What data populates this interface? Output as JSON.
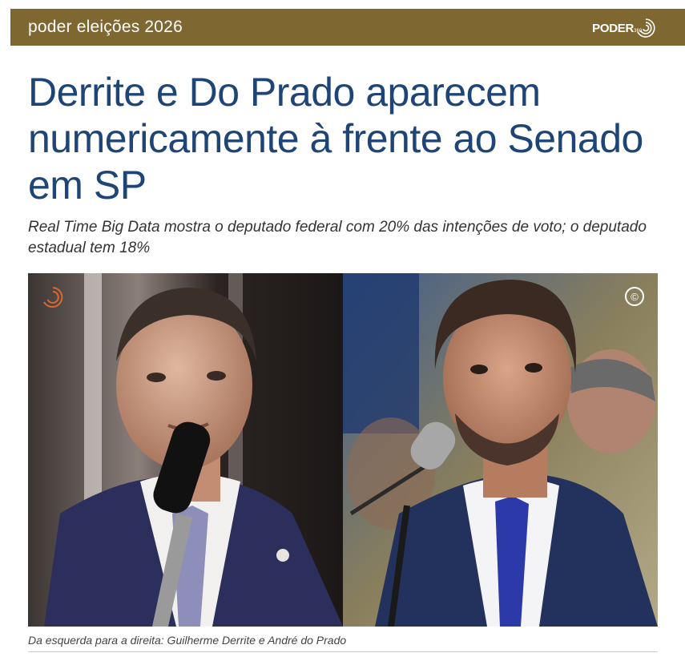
{
  "header": {
    "section_label": "poder eleições 2026",
    "logo_text": "PODER",
    "logo_number": "360",
    "background_color": "#7f6731"
  },
  "article": {
    "headline": "Derrite e Do Prado aparecem numericamente à frente ao Senado em SP",
    "subtitle": "Real Time Big Data mostra o deputado federal com 20% das intenções de voto; o deputado estadual tem 18%",
    "headline_color": "#1f4577",
    "image": {
      "alt": "Guilherme Derrite e André do Prado",
      "left_watermark": "poder360-logo-icon",
      "right_watermark": "copyright-icon"
    },
    "caption": "Da esquerda para a direita: Guilherme Derrite e André do Prado"
  }
}
